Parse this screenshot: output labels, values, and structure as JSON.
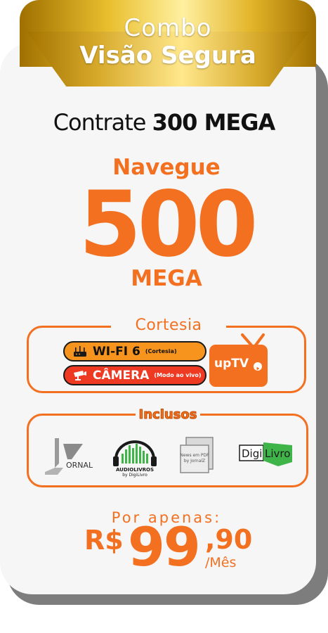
{
  "banner": {
    "line1": "Combo",
    "line2": "Visão Segura"
  },
  "headline": {
    "prefix": "Contrate",
    "speed": "300 MEGA"
  },
  "offer": {
    "top": "Navegue",
    "number": "500",
    "unit": "MEGA"
  },
  "courtesy": {
    "label": "Cortesia",
    "items": [
      {
        "title": "WI-FI 6",
        "note": "(Cortesia)",
        "icon": "router-icon"
      },
      {
        "title": "CÂMERA",
        "note": "(Modo ao vivo)",
        "icon": "camera-icon"
      }
    ],
    "partner": "upTV"
  },
  "included": {
    "label": "Inclusos",
    "logos": [
      {
        "name": "jornalz-logo",
        "text": "ORNAL"
      },
      {
        "name": "audiolivros-logo",
        "text": "AUDIOLIVROS",
        "sub": "by DigiLivro"
      },
      {
        "name": "newspdf-logo",
        "text": "News em PDF",
        "sub": "by JornalZ"
      },
      {
        "name": "digilivro-logo",
        "text": "Digi",
        "text2": "Livro"
      }
    ]
  },
  "price": {
    "lead": "Por apenas:",
    "currency": "R$",
    "whole": "99",
    "cents": ",90",
    "period": "/Mês"
  },
  "colors": {
    "accent": "#f37021",
    "gold": "#e9bf2e",
    "card": "#f6f6f6"
  }
}
